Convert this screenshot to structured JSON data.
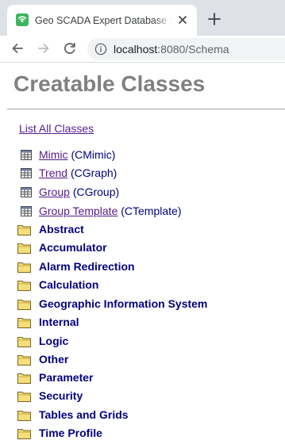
{
  "browser": {
    "tab_title": "Geo SCADA Expert Database Schema",
    "url_host": "localhost",
    "url_path": ":8080/Schema"
  },
  "page": {
    "title": "Creatable Classes",
    "list_all_label": "List All Classes",
    "classes": [
      {
        "name": "Mimic",
        "code": "(CMimic)"
      },
      {
        "name": "Trend",
        "code": "(CGraph)"
      },
      {
        "name": "Group",
        "code": "(CGroup)"
      },
      {
        "name": "Group Template",
        "code": "(CTemplate)"
      }
    ],
    "folders": [
      "Abstract",
      "Accumulator",
      "Alarm Redirection",
      "Calculation",
      "Geographic Information System",
      "Internal",
      "Logic",
      "Other",
      "Parameter",
      "Security",
      "Tables and Grids",
      "Time Profile"
    ]
  },
  "icons": {
    "class_icon": "table-icon",
    "folder_icon": "folder-icon"
  },
  "colors": {
    "link_visited": "#551a8b",
    "code_text": "#000080",
    "folder_label": "#000080",
    "title_gray": "#808080",
    "favicon_green": "#3bb55f"
  }
}
